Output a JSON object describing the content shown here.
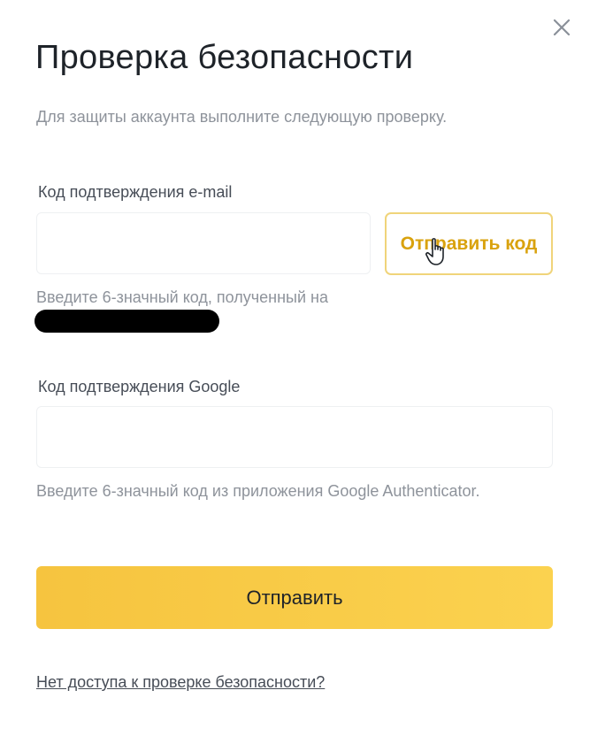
{
  "dialog": {
    "title": "Проверка безопасности",
    "subtitle": "Для защиты аккаунта выполните следующую проверку.",
    "close_icon": "close-icon"
  },
  "email_verification": {
    "label": "Код подтверждения e-mail",
    "value": "",
    "send_code_label": "Отправить код",
    "hint": "Введите 6-значный код, полученный на"
  },
  "google_verification": {
    "label": "Код подтверждения Google",
    "value": "",
    "hint": "Введите 6-значный код из приложения Google Authenticator."
  },
  "submit_label": "Отправить",
  "help_link": "Нет доступа к проверке безопасности?",
  "colors": {
    "accent": "#fcd535",
    "accent_text": "#d9a20d",
    "text_primary": "#1e2329",
    "text_secondary": "#8e939b"
  },
  "icons": {
    "close": "close-icon",
    "cursor": "hand-cursor-icon"
  }
}
